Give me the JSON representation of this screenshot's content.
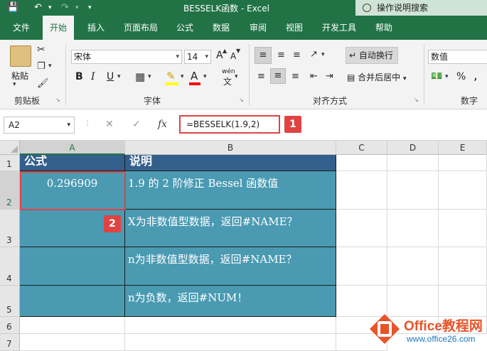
{
  "titlebar": {
    "title": "BESSELK函数  -  Excel",
    "search_placeholder": "操作说明搜索"
  },
  "tabs": [
    "文件",
    "开始",
    "插入",
    "页面布局",
    "公式",
    "数据",
    "审阅",
    "视图",
    "开发工具",
    "帮助"
  ],
  "active_tab": "开始",
  "ribbon": {
    "clipboard": {
      "paste": "粘贴",
      "label": "剪贴板"
    },
    "font": {
      "name": "宋体",
      "size": "14",
      "grow": "A",
      "shrink": "A",
      "bold": "B",
      "italic": "I",
      "underline": "U",
      "label": "字体",
      "phonetic": "wén"
    },
    "align": {
      "wrap": "自动换行",
      "merge": "合并后居中",
      "label": "对齐方式"
    },
    "number": {
      "format": "数值",
      "percent": "%",
      "comma": ",",
      "label": "数字"
    }
  },
  "formula_bar": {
    "name_box": "A2",
    "formula": "=BESSELK(1.9,2)",
    "cancel": "✕",
    "enter": "✓",
    "fx": "fx",
    "badge": "1"
  },
  "sheet": {
    "columns": [
      "A",
      "B",
      "C",
      "D",
      "E"
    ],
    "rows": [
      "1",
      "2",
      "3",
      "4",
      "5",
      "6",
      "7"
    ],
    "header_a": "公式",
    "header_b": "说明",
    "a2": "0.296909",
    "b2": "1.9 的 2 阶修正 Bessel 函数值",
    "b3": "X为非数值型数据，返回#NAME？",
    "b4": "n为非数值型数据，返回#NAME？",
    "b5": "n为负数，返回#NUM！",
    "badge": "2"
  },
  "watermark": {
    "name": "Office教程网",
    "url": "www.office26.com"
  },
  "colors": {
    "excel_green": "#217346",
    "header_blue": "#335f8c",
    "cell_teal": "#4a9ab2",
    "highlight_red": "#e04343",
    "logo_orange": "#e8542a"
  }
}
